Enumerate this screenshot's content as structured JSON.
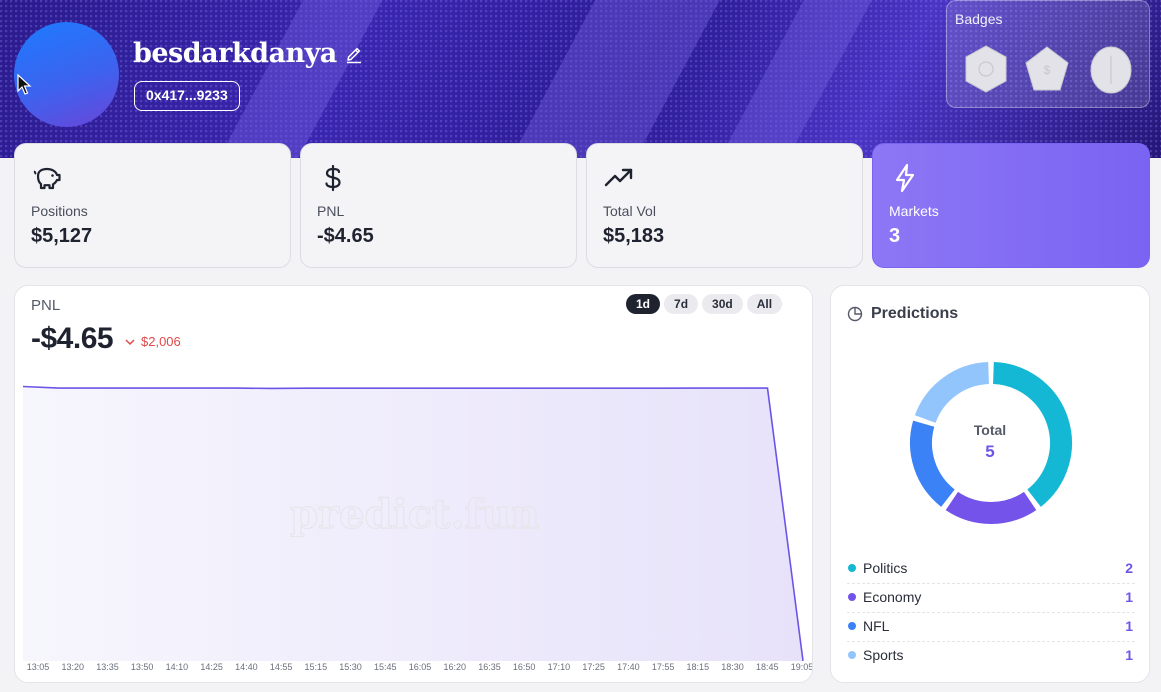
{
  "profile": {
    "username": "besdarkdanya",
    "address": "0x417...9233"
  },
  "badges": {
    "title": "Badges",
    "items": [
      "hexagon-badge",
      "pentagon-badge",
      "egg-badge"
    ]
  },
  "stats": [
    {
      "label": "Positions",
      "value": "$5,127",
      "icon": "piggy-bank-icon"
    },
    {
      "label": "PNL",
      "value": "-$4.65",
      "icon": "dollar-icon"
    },
    {
      "label": "Total Vol",
      "value": "$5,183",
      "icon": "trending-up-icon"
    },
    {
      "label": "Markets",
      "value": "3",
      "icon": "lightning-icon"
    }
  ],
  "pnl": {
    "title": "PNL",
    "value": "-$4.65",
    "change": "$2,006",
    "ranges": [
      "1d",
      "7d",
      "30d",
      "All"
    ],
    "selected_range": "1d",
    "watermark": "predict.fun"
  },
  "chart_data": {
    "type": "area",
    "x": [
      "13:05",
      "13:20",
      "13:35",
      "13:50",
      "14:10",
      "14:25",
      "14:40",
      "14:55",
      "15:15",
      "15:30",
      "15:45",
      "16:05",
      "16:20",
      "16:35",
      "16:50",
      "17:10",
      "17:25",
      "17:40",
      "17:55",
      "18:15",
      "18:30",
      "18:45",
      "19:05"
    ],
    "y": [
      2010,
      1998,
      1998,
      1998,
      1998,
      1998,
      1998,
      1996,
      1997,
      1997,
      1997,
      1997,
      1997,
      1997,
      1997,
      1997,
      1997,
      1997,
      1997,
      1998,
      1998,
      1998,
      1
    ],
    "series": [
      {
        "name": "PNL"
      }
    ],
    "grid": false,
    "colors": {
      "line": "#6b55e6",
      "fill": "#ece8fb"
    }
  },
  "predictions": {
    "title": "Predictions",
    "total_label": "Total",
    "total": "5",
    "categories": [
      {
        "name": "Politics",
        "count": "2",
        "color": "#14b8d4"
      },
      {
        "name": "Economy",
        "count": "1",
        "color": "#7353ea"
      },
      {
        "name": "NFL",
        "count": "1",
        "color": "#3b82f6"
      },
      {
        "name": "Sports",
        "count": "1",
        "color": "#93c5fd"
      }
    ]
  }
}
